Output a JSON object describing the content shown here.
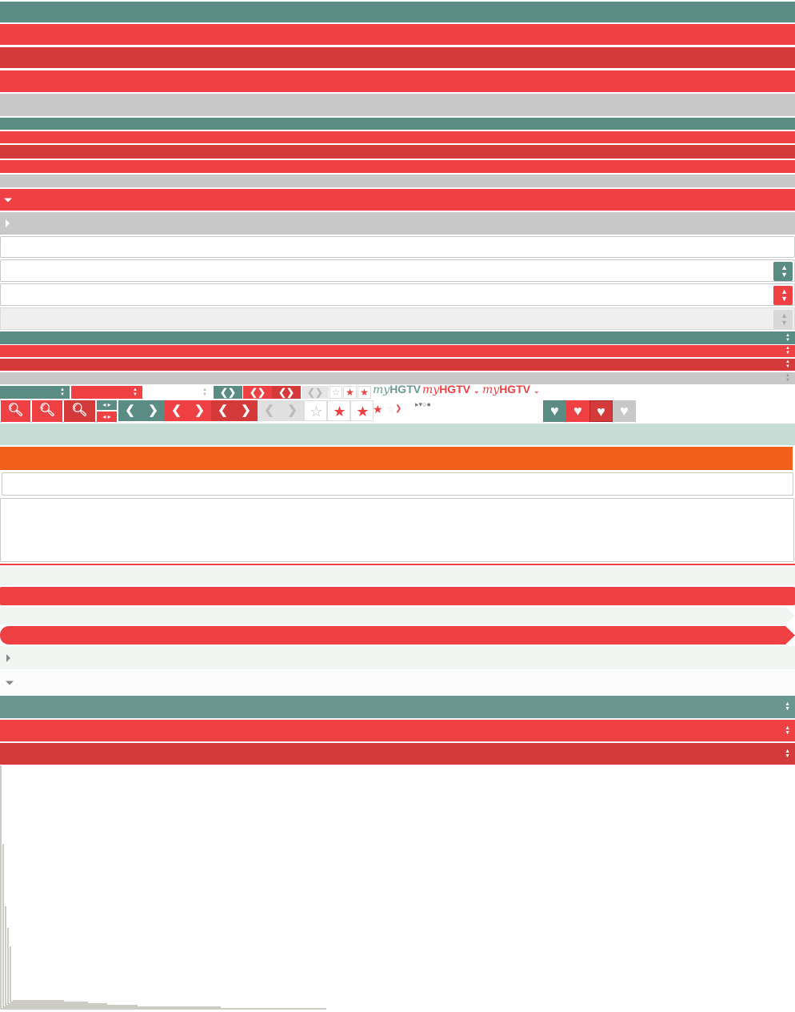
{
  "colors": {
    "teal": "#5b8c83",
    "red": "#ef4043",
    "dark_red": "#d53a3a",
    "grey": "#c8c8c8",
    "light_green": "#c7dcd5",
    "pale": "#f2f6f3",
    "orange": "#f2601a"
  },
  "brand": {
    "prefix": "my",
    "name": "HGTV"
  },
  "icons": {
    "search": "search-icon",
    "resize": "resize-icon",
    "prev": "chevron-left-icon",
    "next": "chevron-right-icon",
    "star_empty": "star-empty-icon",
    "star_half": "star-half-icon",
    "star_full": "star-full-icon",
    "heart": "heart-icon",
    "caret_down": "caret-down-icon",
    "caret_right": "caret-right-icon",
    "spinner": "spinner-arrows-icon"
  }
}
